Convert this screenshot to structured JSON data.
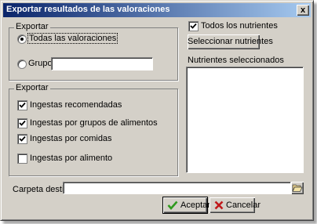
{
  "window": {
    "title": "Exportar resultados de las valoraciones",
    "close_glyph": "x"
  },
  "export_scope": {
    "legend": "Exportar",
    "options": [
      {
        "label": "Todas las valoraciones",
        "selected": true
      },
      {
        "label": "Grupo",
        "selected": false
      }
    ],
    "group_input": ""
  },
  "export_types": {
    "legend": "Exportar",
    "items": [
      {
        "label": "Ingestas recomendadas",
        "checked": true
      },
      {
        "label": "Ingestas por grupos de alimentos",
        "checked": true
      },
      {
        "label": "Ingestas por comidas",
        "checked": true
      },
      {
        "label": "Ingestas por alimento",
        "checked": false
      }
    ]
  },
  "nutrients": {
    "all_label": "Todos los nutrientes",
    "all_checked": true,
    "select_button": "Seleccionar nutrientes",
    "selected_label": "Nutrientes seleccionados",
    "selected_items": []
  },
  "destination": {
    "label": "Carpeta destino",
    "value": "",
    "browse_icon": "folder-open-icon"
  },
  "actions": {
    "accept": "Aceptar",
    "cancel": "Cancelar"
  },
  "colors": {
    "titlebar_start": "#0a246a",
    "titlebar_end": "#a6caf0",
    "accept_check": "#2f9a1e",
    "cancel_x": "#c0181a"
  }
}
